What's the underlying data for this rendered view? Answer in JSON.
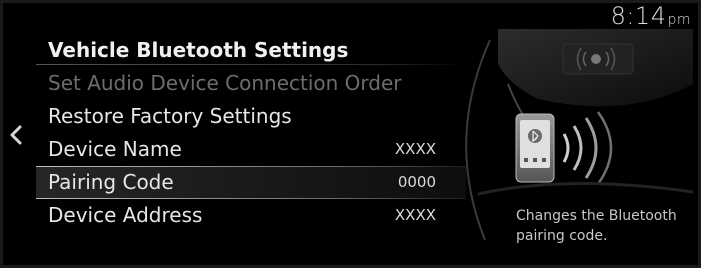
{
  "status": {
    "time": "8:14",
    "ampm": "pm"
  },
  "nav": {
    "back_icon": "chevron-left-icon"
  },
  "menu": {
    "title": "Vehicle Bluetooth Settings",
    "items": [
      {
        "label": "Set Audio Device Connection Order",
        "value": "",
        "state": "disabled"
      },
      {
        "label": "Restore Factory Settings",
        "value": "",
        "state": "normal"
      },
      {
        "label": "Device Name",
        "value": "XXXX",
        "state": "normal"
      },
      {
        "label": "Pairing Code",
        "value": "0000",
        "state": "selected"
      },
      {
        "label": "Device Address",
        "value": "XXXX",
        "state": "normal"
      }
    ]
  },
  "help": {
    "description": "Changes the Bluetooth pairing code.",
    "illustration_icon": "bluetooth-phone-icon"
  },
  "colors": {
    "background": "#000000",
    "text": "#e6e6e6",
    "disabled_text": "#6d6d6d",
    "highlight": "#2a2a2a"
  }
}
